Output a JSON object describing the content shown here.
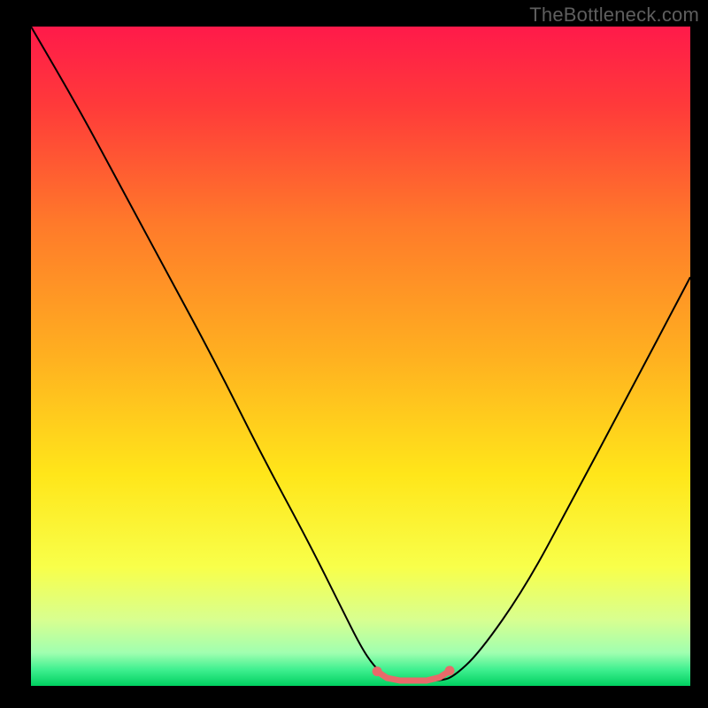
{
  "watermark": "TheBottleneck.com",
  "gradient_stops": [
    {
      "offset": 0.0,
      "color": "#ff1a4a"
    },
    {
      "offset": 0.12,
      "color": "#ff3a3a"
    },
    {
      "offset": 0.3,
      "color": "#ff7a2a"
    },
    {
      "offset": 0.5,
      "color": "#ffb020"
    },
    {
      "offset": 0.68,
      "color": "#ffe61a"
    },
    {
      "offset": 0.82,
      "color": "#f8ff4a"
    },
    {
      "offset": 0.9,
      "color": "#d8ff90"
    },
    {
      "offset": 0.95,
      "color": "#a0ffb0"
    },
    {
      "offset": 0.975,
      "color": "#40f090"
    },
    {
      "offset": 1.0,
      "color": "#00d060"
    }
  ],
  "chart_data": {
    "type": "line",
    "title": "",
    "xlabel": "",
    "ylabel": "",
    "xlim": [
      0,
      100
    ],
    "ylim": [
      0,
      100
    ],
    "series": [
      {
        "name": "curve",
        "x": [
          0,
          7,
          14,
          21,
          28,
          35,
          42,
          47,
          50,
          52,
          54,
          56,
          58,
          60,
          62,
          64,
          68,
          75,
          82,
          90,
          100
        ],
        "values": [
          100,
          88,
          75,
          62,
          49,
          35,
          22,
          12,
          6,
          3,
          1.2,
          0.8,
          0.8,
          0.8,
          0.8,
          1.3,
          5,
          15,
          28,
          43,
          62
        ]
      },
      {
        "name": "minimum-marker",
        "x": [
          52.5,
          54,
          56,
          58,
          60,
          62,
          63.5
        ],
        "values": [
          2.2,
          1.2,
          0.8,
          0.8,
          0.8,
          1.3,
          2.3
        ]
      }
    ],
    "marker_dots": [
      {
        "x": 52.5,
        "y": 2.2
      },
      {
        "x": 63.5,
        "y": 2.3
      }
    ],
    "legend": []
  },
  "styles": {
    "curve_stroke": "#000000",
    "curve_width": 2,
    "marker_stroke": "#e86a6a",
    "marker_width": 7
  }
}
